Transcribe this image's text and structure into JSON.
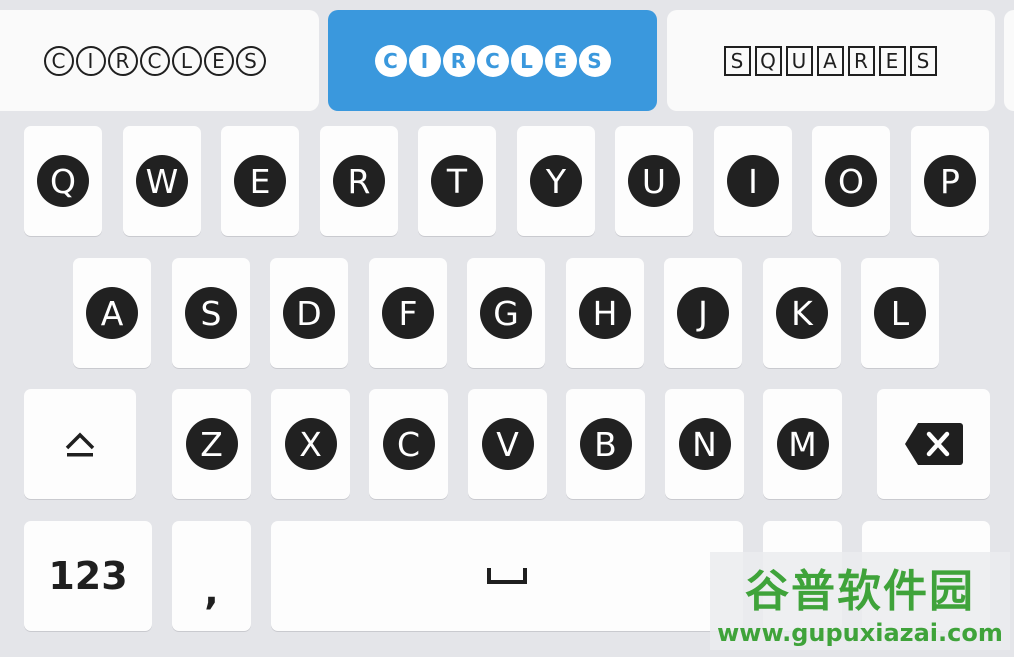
{
  "style_strip": [
    {
      "name": "circles-outline",
      "letters": [
        "C",
        "I",
        "R",
        "C",
        "L",
        "E",
        "S"
      ],
      "selected": false
    },
    {
      "name": "circles-filled",
      "letters": [
        "C",
        "I",
        "R",
        "C",
        "L",
        "E",
        "S"
      ],
      "selected": true
    },
    {
      "name": "squares",
      "letters": [
        "S",
        "Q",
        "U",
        "A",
        "R",
        "E",
        "S"
      ],
      "selected": false
    }
  ],
  "keyboard": {
    "row1": [
      "Q",
      "W",
      "E",
      "R",
      "T",
      "Y",
      "U",
      "I",
      "O",
      "P"
    ],
    "row2": [
      "A",
      "S",
      "D",
      "F",
      "G",
      "H",
      "J",
      "K",
      "L"
    ],
    "row3": [
      "Z",
      "X",
      "C",
      "V",
      "B",
      "N",
      "M"
    ],
    "shift_icon": "shift-icon",
    "backspace_icon": "backspace-icon",
    "numbers_label": "123",
    "comma_label": ",",
    "space_icon": "space-icon"
  },
  "watermark": {
    "title": "谷普软件园",
    "url": "www.gupuxiazai.com"
  },
  "colors": {
    "accent": "#3a98dd",
    "key_bg": "#fdfdfd",
    "keyboard_bg": "#e4e5e9",
    "glyph": "#212121",
    "watermark": "#3fa33a"
  }
}
